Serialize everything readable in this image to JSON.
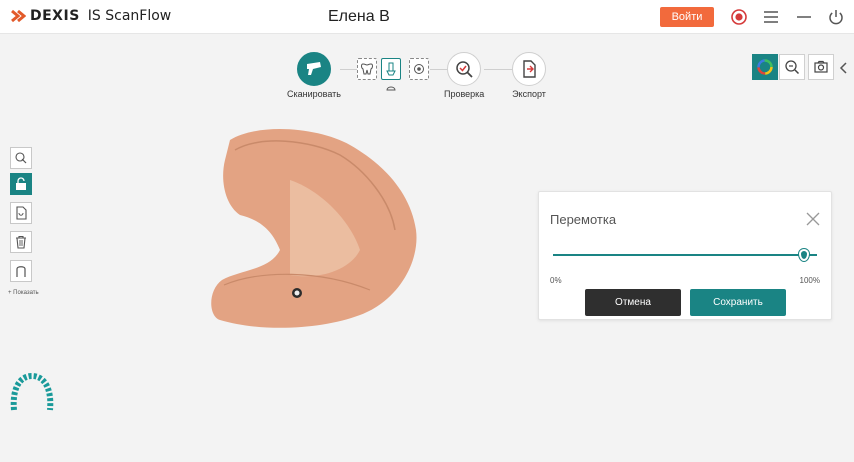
{
  "app": {
    "brand": "DEXIS",
    "product": "IS ScanFlow",
    "patient_name": "Елена В",
    "login_label": "Войти"
  },
  "titlebar_icons": [
    "record-icon",
    "menu-icon",
    "minimize-icon",
    "power-icon"
  ],
  "workflow": {
    "steps": [
      {
        "label": "Сканировать",
        "icon": "scanner-icon",
        "active": true
      },
      {
        "label": "Проверка",
        "icon": "inspect-icon",
        "active": false
      },
      {
        "label": "Экспорт",
        "icon": "export-icon",
        "active": false
      }
    ],
    "scan_substeps": [
      "upper-jaw-icon",
      "scan-body-icon",
      "settings-icon"
    ],
    "active_substep": 1
  },
  "right_tools": [
    "color-wheel-icon",
    "zoom-icon",
    "camera-icon"
  ],
  "left_tools": {
    "items": [
      "cursor-icon",
      "lock-icon",
      "note-icon",
      "trash-icon",
      "margin-icon"
    ],
    "active_index": 1,
    "note_label": "+ Показать"
  },
  "dialog": {
    "title": "Перемотка",
    "min_label": "0%",
    "max_label": "100%",
    "slider_value_fraction": 0.96,
    "cancel_label": "Отмена",
    "save_label": "Сохранить"
  },
  "colors": {
    "accent": "#1a8484",
    "login": "#f26a3c",
    "model": "#e3a383"
  }
}
